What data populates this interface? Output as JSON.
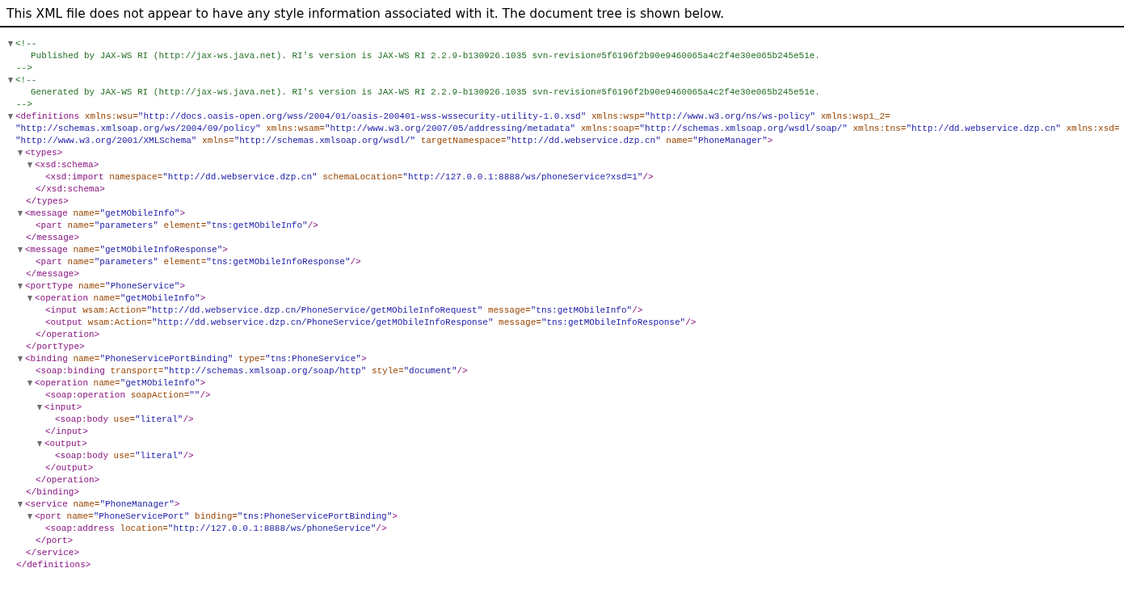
{
  "notice": "This XML file does not appear to have any style information associated with it. The document tree is shown below.",
  "tree": [
    {
      "kind": "comment",
      "expanded": true,
      "open": "<!--",
      "text": "Published by JAX-WS RI (http://jax-ws.java.net). RI's version is JAX-WS RI 2.2.9-b130926.1035 svn-revision#5f6196f2b90e9460065a4c2f4e30e065b245e51e.",
      "close": "-->"
    },
    {
      "kind": "comment",
      "expanded": true,
      "open": "<!--",
      "text": "Generated by JAX-WS RI (http://jax-ws.java.net). RI's version is JAX-WS RI 2.2.9-b130926.1035 svn-revision#5f6196f2b90e9460065a4c2f4e30e065b245e51e.",
      "close": "-->"
    },
    {
      "kind": "element",
      "tag": "<definitions",
      "end": ">",
      "closing_tag": "</definitions>",
      "expanded": true,
      "attributes": [
        {
          "name": "xmlns:wsu=",
          "value": "\"http://docs.oasis-open.org/wss/2004/01/oasis-200401-wss-wssecurity-utility-1.0.xsd\""
        },
        {
          "name": "xmlns:wsp=",
          "value": "\"http://www.w3.org/ns/ws-policy\""
        },
        {
          "name": "xmlns:wsp1_2=",
          "value": "\"http://schemas.xmlsoap.org/ws/2004/09/policy\""
        },
        {
          "name": "xmlns:wsam=",
          "value": "\"http://www.w3.org/2007/05/addressing/metadata\""
        },
        {
          "name": "xmlns:soap=",
          "value": "\"http://schemas.xmlsoap.org/wsdl/soap/\""
        },
        {
          "name": "xmlns:tns=",
          "value": "\"http://dd.webservice.dzp.cn\""
        },
        {
          "name": "xmlns:xsd=",
          "value": "\"http://www.w3.org/2001/XMLSchema\""
        },
        {
          "name": "xmlns=",
          "value": "\"http://schemas.xmlsoap.org/wsdl/\""
        },
        {
          "name": "targetNamespace=",
          "value": "\"http://dd.webservice.dzp.cn\""
        },
        {
          "name": "name=",
          "value": "\"PhoneManager\""
        }
      ],
      "children": [
        {
          "kind": "element",
          "tag": "<types",
          "end": ">",
          "closing_tag": "</types>",
          "expanded": true,
          "children": [
            {
              "kind": "element",
              "tag": "<xsd:schema",
              "end": ">",
              "closing_tag": "</xsd:schema>",
              "expanded": true,
              "children": [
                {
                  "kind": "element",
                  "tag": "<xsd:import",
                  "end": "/>",
                  "attributes": [
                    {
                      "name": "namespace=",
                      "value": "\"http://dd.webservice.dzp.cn\""
                    },
                    {
                      "name": "schemaLocation=",
                      "value": "\"http://127.0.0.1:8888/ws/phoneService?xsd=1\""
                    }
                  ]
                }
              ]
            }
          ]
        },
        {
          "kind": "element",
          "tag": "<message",
          "end": ">",
          "closing_tag": "</message>",
          "expanded": true,
          "attributes": [
            {
              "name": "name=",
              "value": "\"getMObileInfo\""
            }
          ],
          "children": [
            {
              "kind": "element",
              "tag": "<part",
              "end": "/>",
              "attributes": [
                {
                  "name": "name=",
                  "value": "\"parameters\""
                },
                {
                  "name": "element=",
                  "value": "\"tns:getMObileInfo\""
                }
              ]
            }
          ]
        },
        {
          "kind": "element",
          "tag": "<message",
          "end": ">",
          "closing_tag": "</message>",
          "expanded": true,
          "attributes": [
            {
              "name": "name=",
              "value": "\"getMObileInfoResponse\""
            }
          ],
          "children": [
            {
              "kind": "element",
              "tag": "<part",
              "end": "/>",
              "attributes": [
                {
                  "name": "name=",
                  "value": "\"parameters\""
                },
                {
                  "name": "element=",
                  "value": "\"tns:getMObileInfoResponse\""
                }
              ]
            }
          ]
        },
        {
          "kind": "element",
          "tag": "<portType",
          "end": ">",
          "closing_tag": "</portType>",
          "expanded": true,
          "attributes": [
            {
              "name": "name=",
              "value": "\"PhoneService\""
            }
          ],
          "children": [
            {
              "kind": "element",
              "tag": "<operation",
              "end": ">",
              "closing_tag": "</operation>",
              "expanded": true,
              "attributes": [
                {
                  "name": "name=",
                  "value": "\"getMObileInfo\""
                }
              ],
              "children": [
                {
                  "kind": "element",
                  "tag": "<input",
                  "end": "/>",
                  "attributes": [
                    {
                      "name": "wsam:Action=",
                      "value": "\"http://dd.webservice.dzp.cn/PhoneService/getMObileInfoRequest\""
                    },
                    {
                      "name": "message=",
                      "value": "\"tns:getMObileInfo\""
                    }
                  ]
                },
                {
                  "kind": "element",
                  "tag": "<output",
                  "end": "/>",
                  "attributes": [
                    {
                      "name": "wsam:Action=",
                      "value": "\"http://dd.webservice.dzp.cn/PhoneService/getMObileInfoResponse\""
                    },
                    {
                      "name": "message=",
                      "value": "\"tns:getMObileInfoResponse\""
                    }
                  ]
                }
              ]
            }
          ]
        },
        {
          "kind": "element",
          "tag": "<binding",
          "end": ">",
          "closing_tag": "</binding>",
          "expanded": true,
          "attributes": [
            {
              "name": "name=",
              "value": "\"PhoneServicePortBinding\""
            },
            {
              "name": "type=",
              "value": "\"tns:PhoneService\""
            }
          ],
          "children": [
            {
              "kind": "element",
              "tag": "<soap:binding",
              "end": "/>",
              "attributes": [
                {
                  "name": "transport=",
                  "value": "\"http://schemas.xmlsoap.org/soap/http\""
                },
                {
                  "name": "style=",
                  "value": "\"document\""
                }
              ]
            },
            {
              "kind": "element",
              "tag": "<operation",
              "end": ">",
              "closing_tag": "</operation>",
              "expanded": true,
              "attributes": [
                {
                  "name": "name=",
                  "value": "\"getMObileInfo\""
                }
              ],
              "children": [
                {
                  "kind": "element",
                  "tag": "<soap:operation",
                  "end": "/>",
                  "attributes": [
                    {
                      "name": "soapAction=",
                      "value": "\"\""
                    }
                  ]
                },
                {
                  "kind": "element",
                  "tag": "<input",
                  "end": ">",
                  "closing_tag": "</input>",
                  "expanded": true,
                  "children": [
                    {
                      "kind": "element",
                      "tag": "<soap:body",
                      "end": "/>",
                      "attributes": [
                        {
                          "name": "use=",
                          "value": "\"literal\""
                        }
                      ]
                    }
                  ]
                },
                {
                  "kind": "element",
                  "tag": "<output",
                  "end": ">",
                  "closing_tag": "</output>",
                  "expanded": true,
                  "children": [
                    {
                      "kind": "element",
                      "tag": "<soap:body",
                      "end": "/>",
                      "attributes": [
                        {
                          "name": "use=",
                          "value": "\"literal\""
                        }
                      ]
                    }
                  ]
                }
              ]
            }
          ]
        },
        {
          "kind": "element",
          "tag": "<service",
          "end": ">",
          "closing_tag": "</service>",
          "expanded": true,
          "attributes": [
            {
              "name": "name=",
              "value": "\"PhoneManager\""
            }
          ],
          "children": [
            {
              "kind": "element",
              "tag": "<port",
              "end": ">",
              "closing_tag": "</port>",
              "expanded": true,
              "attributes": [
                {
                  "name": "name=",
                  "value": "\"PhoneServicePort\""
                },
                {
                  "name": "binding=",
                  "value": "\"tns:PhoneServicePortBinding\""
                }
              ],
              "children": [
                {
                  "kind": "element",
                  "tag": "<soap:address",
                  "end": "/>",
                  "attributes": [
                    {
                      "name": "location=",
                      "value": "\"http://127.0.0.1:8888/ws/phoneService\""
                    }
                  ]
                }
              ]
            }
          ]
        }
      ]
    }
  ]
}
